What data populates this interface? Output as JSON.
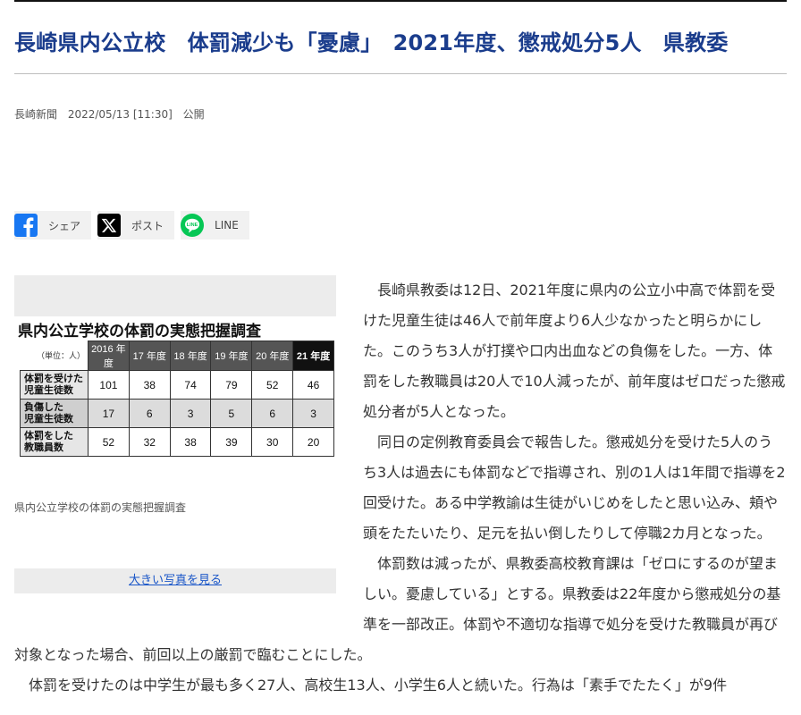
{
  "article": {
    "title": "長崎県内公立校　体罰減少も「憂慮」　2021年度、懲戒処分5人　県教委",
    "source": "長崎新聞",
    "datetime": "2022/05/13 [11:30]",
    "status": "公開"
  },
  "share": {
    "facebook_label": "シェア",
    "x_label": "ポスト",
    "line_label": "LINE"
  },
  "figure": {
    "title": "県内公立学校の体罰の実態把握調査",
    "unit": "（単位：人）",
    "columns": [
      "2016 年度",
      "17 年度",
      "18 年度",
      "19 年度",
      "20 年度",
      "21 年度"
    ],
    "rows": [
      {
        "label_line1": "体罰を受けた",
        "label_line2": "児童生徒数",
        "values": [
          "101",
          "38",
          "74",
          "79",
          "52",
          "46"
        ]
      },
      {
        "label_line1": "負傷した",
        "label_line2": "児童生徒数",
        "values": [
          "17",
          "6",
          "3",
          "5",
          "6",
          "3"
        ]
      },
      {
        "label_line1": "体罰をした",
        "label_line2": "教職員数",
        "values": [
          "52",
          "32",
          "38",
          "39",
          "30",
          "20"
        ]
      }
    ],
    "caption": "県内公立学校の体罰の実態把握調査",
    "big_photo_link": "大きい写真を見る"
  },
  "body": {
    "paragraphs": [
      "長崎県教委は12日、2021年度に県内の公立小中高で体罰を受けた児童生徒は46人で前年度より6人少なかったと明らかにした。このうち3人が打撲や口内出血などの負傷をした。一方、体罰をした教職員は20人で10人減ったが、前年度はゼロだった懲戒処分者が5人となった。",
      "同日の定例教育委員会で報告した。懲戒処分を受けた5人のうち3人は過去にも体罰などで指導され、別の1人は1年間で指導を2回受けた。ある中学教諭は生徒がいじめをしたと思い込み、頬や頭をたたいたり、足元を払い倒したりして停職2カ月となった。",
      "体罰数は減ったが、県教委高校教育課は「ゼロにするのが望ましい。憂慮している」とする。県教委は22年度から懲戒処分の基準を一部改正。体罰や不適切な指導で処分を受けた教職員が再び対象となった場合、前回以上の厳罰で臨むことにした。",
      "体罰を受けたのは中学生が最も多く27人、高校生13人、小学生6人と続いた。行為は「素手でたたく」が9件"
    ]
  }
}
